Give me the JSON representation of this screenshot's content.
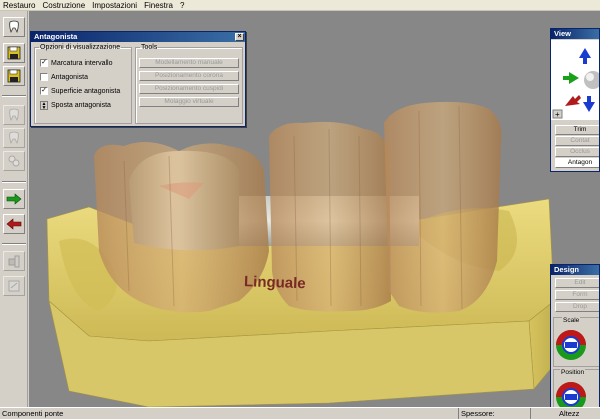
{
  "menu": [
    "Restauro",
    "Costruzione",
    "Impostazioni",
    "Finestra",
    "?"
  ],
  "antagonista": {
    "title": "Antagonista",
    "options_legend": "Opzioni di visualizzazione",
    "checkboxes": [
      {
        "label": "Marcatura intervallo",
        "checked": true
      },
      {
        "label": "Antagonista",
        "checked": false
      },
      {
        "label": "Superficie antagonista",
        "checked": true
      }
    ],
    "move_label": "Sposta antagonista",
    "tools_legend": "Tools",
    "tools": [
      "Modellamento manuale",
      "Posizionamento corona",
      "Posizionamento cuspidi",
      "Molaggio virtuale"
    ]
  },
  "view": {
    "title": "View",
    "buttons": [
      "Trim",
      "Contat",
      "Occlus",
      "Antagon"
    ]
  },
  "design": {
    "title": "Design",
    "buttons": [
      "Edit",
      "Form",
      "Drop"
    ],
    "groups": [
      "Scale",
      "Position"
    ]
  },
  "viewport": {
    "label": "Linguale"
  },
  "status": {
    "left": "Componenti ponte",
    "thickness_label": "Spessore:",
    "height_label": "Altezz"
  },
  "colors": {
    "model": "#e0cf6e",
    "crown": "#c9a16a",
    "background": "#878787",
    "title_bar": "#0a246a"
  }
}
